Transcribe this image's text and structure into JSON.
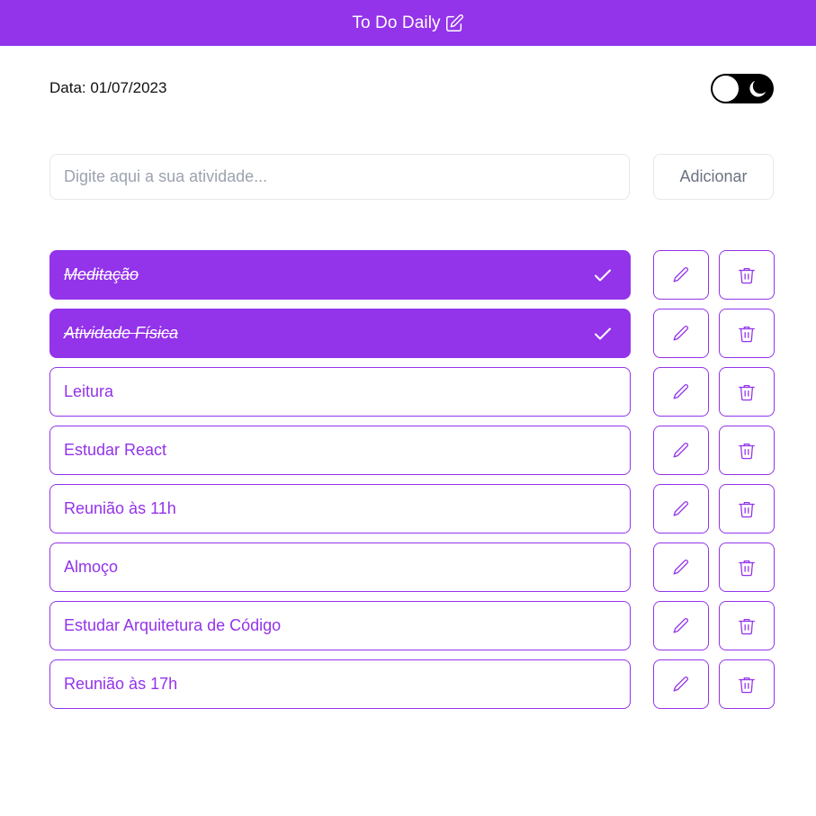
{
  "header": {
    "title": "To Do Daily",
    "icon": "edit-icon"
  },
  "date_text": "Data: 01/07/2023",
  "theme_toggle": {
    "icon": "moon-icon"
  },
  "new_task": {
    "placeholder": "Digite aqui a sua atividade...",
    "value": "",
    "add_label": "Adicionar"
  },
  "colors": {
    "accent": "#9333ea",
    "border_muted": "#e5e7eb"
  },
  "tasks": [
    {
      "label": "Meditação",
      "done": true
    },
    {
      "label": "Atividade Física",
      "done": true
    },
    {
      "label": "Leitura",
      "done": false
    },
    {
      "label": "Estudar React",
      "done": false
    },
    {
      "label": "Reunião às 11h",
      "done": false
    },
    {
      "label": "Almoço",
      "done": false
    },
    {
      "label": "Estudar Arquitetura de Código",
      "done": false
    },
    {
      "label": "Reunião às 17h",
      "done": false
    }
  ]
}
